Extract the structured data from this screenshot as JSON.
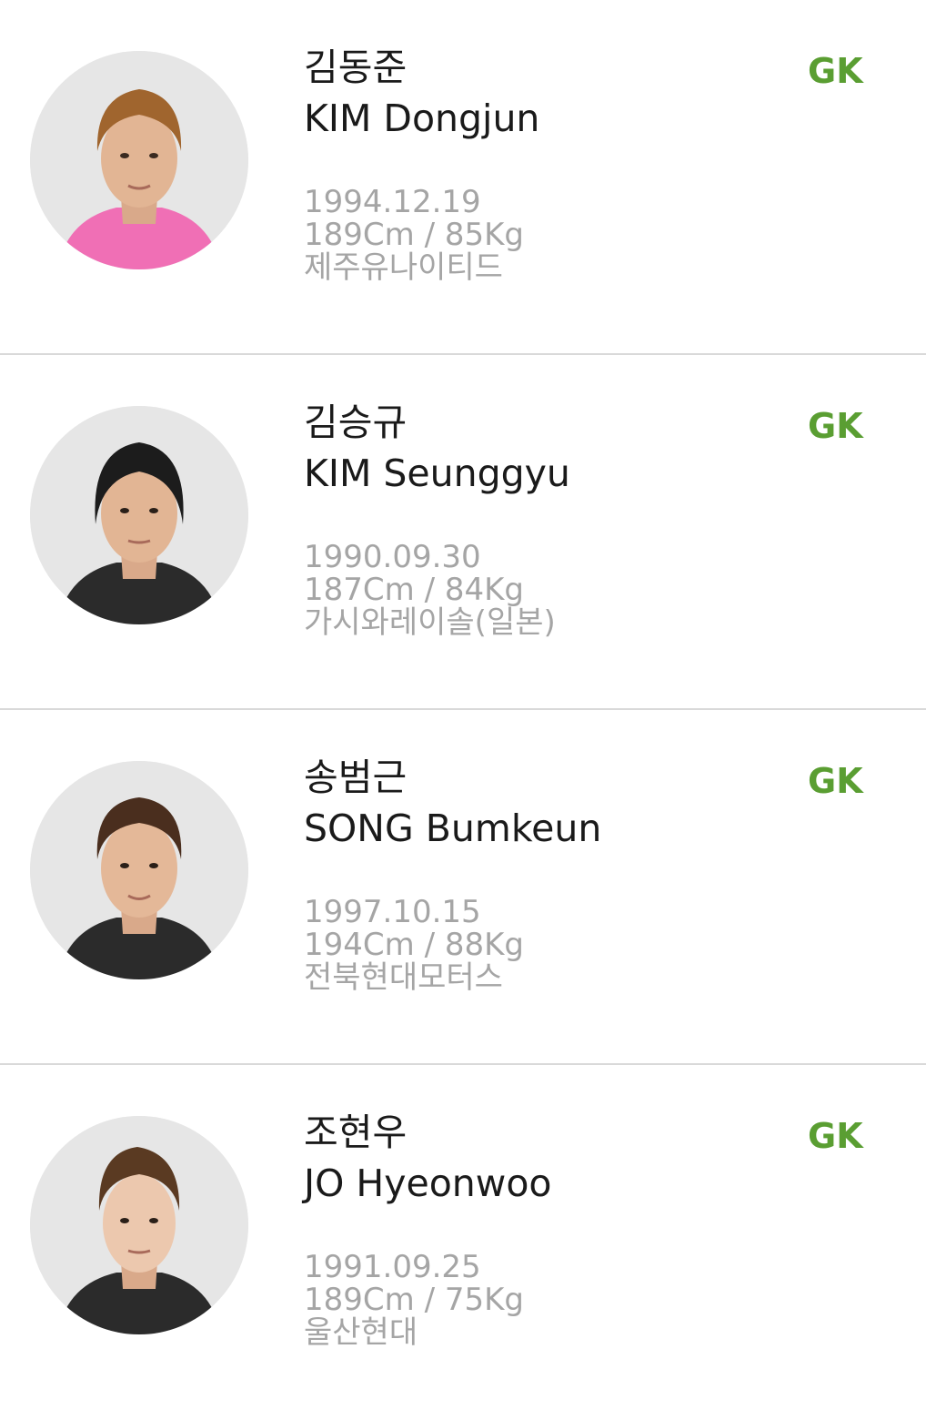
{
  "players": [
    {
      "name_ko": "김동준",
      "name_en": "KIM Dongjun",
      "position": "GK",
      "birth": "1994.12.19",
      "body": "189Cm / 85Kg",
      "team": "제주유나이티드",
      "jersey_color": "#f06fb5"
    },
    {
      "name_ko": "김승규",
      "name_en": "KIM Seunggyu",
      "position": "GK",
      "birth": "1990.09.30",
      "body": "187Cm / 84Kg",
      "team": "가시와레이솔(일본)",
      "jersey_color": "#2b2b2b"
    },
    {
      "name_ko": "송범근",
      "name_en": "SONG Bumkeun",
      "position": "GK",
      "birth": "1997.10.15",
      "body": "194Cm / 88Kg",
      "team": "전북현대모터스",
      "jersey_color": "#2b2b2b"
    },
    {
      "name_ko": "조현우",
      "name_en": "JO Hyeonwoo",
      "position": "GK",
      "birth": "1991.09.25",
      "body": "189Cm / 75Kg",
      "team": "울산현대",
      "jersey_color": "#2b2b2b"
    }
  ],
  "colors": {
    "position_accent": "#5a9e32",
    "meta_text": "#a5a5a5",
    "divider": "#d9d9d9"
  }
}
